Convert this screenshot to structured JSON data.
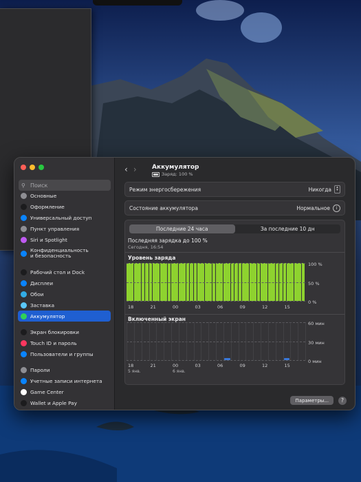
{
  "colors": {
    "accent": "#1f5fd1",
    "charge_green": "#8ed22f",
    "screen_blue": "#3a78d8",
    "window_bg": "#2a2a2c",
    "sidebar_bg": "#333235"
  },
  "sidebar": {
    "search_placeholder": "Поиск",
    "items": [
      {
        "label": "Основные",
        "icon": "gear-icon",
        "color": "#8e8e93",
        "group": 1
      },
      {
        "label": "Оформление",
        "icon": "appearance-icon",
        "color": "#1c1c1e",
        "group": 1
      },
      {
        "label": "Универсальный доступ",
        "icon": "accessibility-icon",
        "color": "#0a84ff",
        "group": 1
      },
      {
        "label": "Пункт управления",
        "icon": "control-center-icon",
        "color": "#8e8e93",
        "group": 1
      },
      {
        "label": "Siri и Spotlight",
        "icon": "siri-icon",
        "color": "#bf5af2",
        "group": 1
      },
      {
        "label": "Конфиденциальность\nи безопасность",
        "icon": "privacy-hand-icon",
        "color": "#0a84ff",
        "group": 1
      },
      {
        "label": "Рабочий стол и Dock",
        "icon": "dock-icon",
        "color": "#1c1c1e",
        "group": 2
      },
      {
        "label": "Дисплеи",
        "icon": "display-icon",
        "color": "#0a84ff",
        "group": 2
      },
      {
        "label": "Обои",
        "icon": "wallpaper-icon",
        "color": "#32ade6",
        "group": 2
      },
      {
        "label": "Заставка",
        "icon": "screensaver-icon",
        "color": "#5ac8fa",
        "group": 2
      },
      {
        "label": "Аккумулятор",
        "icon": "battery-icon",
        "color": "#30d158",
        "group": 2,
        "selected": true
      },
      {
        "label": "Экран блокировки",
        "icon": "lock-screen-icon",
        "color": "#1c1c1e",
        "group": 3
      },
      {
        "label": "Touch ID и пароль",
        "icon": "fingerprint-icon",
        "color": "#ff375f",
        "group": 3
      },
      {
        "label": "Пользователи и группы",
        "icon": "users-icon",
        "color": "#0a84ff",
        "group": 3
      },
      {
        "label": "Пароли",
        "icon": "key-icon",
        "color": "#8e8e93",
        "group": 4
      },
      {
        "label": "Учетные записи интернета",
        "icon": "at-icon",
        "color": "#0a84ff",
        "group": 4
      },
      {
        "label": "Game Center",
        "icon": "game-center-icon",
        "color": "#ffffff",
        "group": 4
      },
      {
        "label": "Wallet и Apple Pay",
        "icon": "wallet-icon",
        "color": "#1c1c1e",
        "group": 4
      }
    ]
  },
  "header": {
    "title": "Аккумулятор",
    "subtitle": "Заряд: 100 %"
  },
  "settings": {
    "power_saving_label": "Режим энергосбережения",
    "power_saving_value": "Никогда",
    "battery_state_label": "Состояние аккумулятора",
    "battery_state_value": "Нормальное"
  },
  "chart_panel": {
    "tab_24h": "Последние 24 часа",
    "tab_10d": "За последние 10 дн",
    "active_tab": "tab_24h",
    "last_charge_label": "Последняя зарядка до 100 %",
    "last_charge_time": "Сегодня, 16:54",
    "charge_section_title": "Уровень заряда",
    "screen_section_title": "Включенный экран"
  },
  "chart_data": [
    {
      "type": "bar",
      "title": "Уровень заряда",
      "x_ticks": [
        "18",
        "21",
        "00",
        "03",
        "06",
        "09",
        "12",
        "15"
      ],
      "y_ticks": [
        "100 %",
        "50 %",
        "0 %"
      ],
      "ylim": [
        0,
        100
      ],
      "bars_count": 48,
      "values_percent": 100,
      "note_bars": "all intervals at 100 %"
    },
    {
      "type": "bar",
      "title": "Включенный экран",
      "x_ticks": [
        "18",
        "21",
        "00",
        "03",
        "06",
        "09",
        "12",
        "15"
      ],
      "x_sub_ticks": [
        "5 янв.",
        "6 янв."
      ],
      "y_ticks": [
        "60 мин",
        "30 мин",
        "0 мин"
      ],
      "ylim": [
        0,
        60
      ],
      "bars": [
        {
          "hour_index": 13,
          "minutes": 3
        },
        {
          "hour_index": 21,
          "minutes": 2
        }
      ]
    }
  ],
  "footer": {
    "params_button": "Параметры...",
    "help_button": "?"
  }
}
